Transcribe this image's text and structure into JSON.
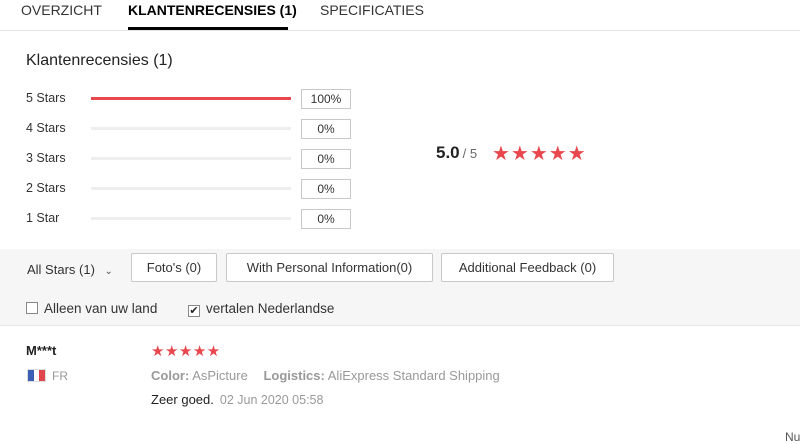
{
  "tabs": [
    {
      "label": "OVERZICHT"
    },
    {
      "label": "KLANTENRECENSIES (1)"
    },
    {
      "label": "SPECIFICATIES"
    }
  ],
  "section_title": "Klantenrecensies (1)",
  "rating_breakdown": [
    {
      "label": "5 Stars",
      "percent": "100%",
      "fraction": 1.0
    },
    {
      "label": "4 Stars",
      "percent": "0%",
      "fraction": 0
    },
    {
      "label": "3 Stars",
      "percent": "0%",
      "fraction": 0
    },
    {
      "label": "2 Stars",
      "percent": "0%",
      "fraction": 0
    },
    {
      "label": "1 Star",
      "percent": "0%",
      "fraction": 0
    }
  ],
  "overall": {
    "score": "5.0",
    "out_of": "/ 5",
    "stars": "★★★★★"
  },
  "filters": {
    "all_stars": "All Stars (1)",
    "buttons": [
      "Foto's (0)",
      "With Personal Information(0)",
      "Additional Feedback (0)"
    ],
    "checkboxes": [
      {
        "label": "Alleen van uw land",
        "checked": false
      },
      {
        "label": "vertalen Nederlandse",
        "checked": true
      }
    ]
  },
  "review": {
    "reviewer": "M***t",
    "country": "FR",
    "stars": "★★★★★",
    "color_label": "Color:",
    "color_value": "AsPicture",
    "logistics_label": "Logistics:",
    "logistics_value": "AliExpress Standard Shipping",
    "text": "Zeer goed.",
    "date": "02 Jun 2020 05:58"
  },
  "cut_off_text": "Nu",
  "colors": {
    "accent": "#e8484d",
    "flag_blue": "#3a5fb5",
    "flag_red": "#e0474c"
  }
}
